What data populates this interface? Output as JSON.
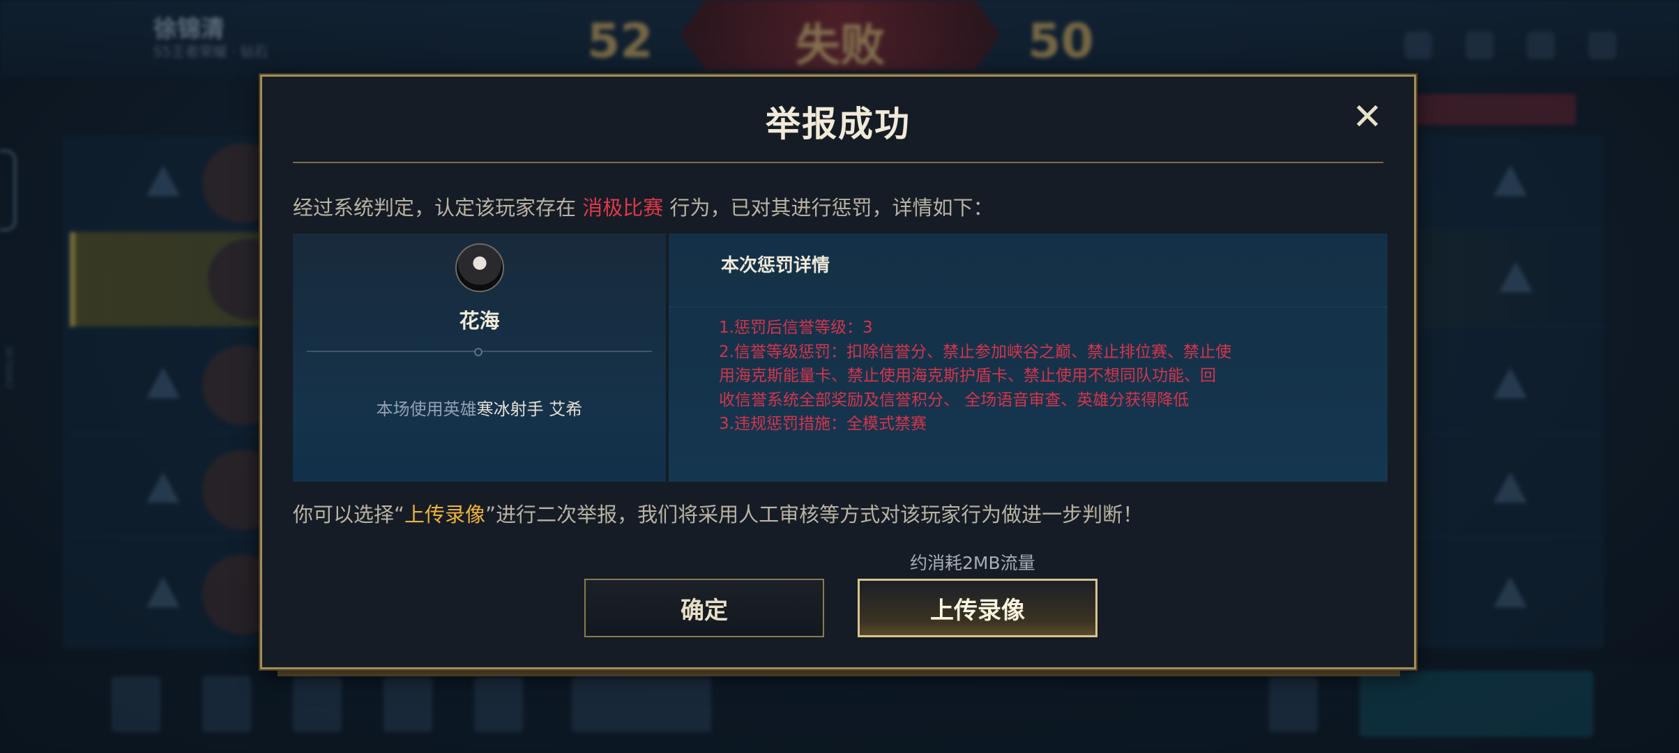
{
  "background": {
    "player_name": "徐锦清",
    "player_sub": "S5王者荣耀 · 钻石",
    "score_left": "52",
    "score_right": "50",
    "result_text": "失败",
    "side_text": "3670043"
  },
  "modal": {
    "title": "举报成功",
    "close_symbol": "✕",
    "intro_before": "经过系统判定，认定该玩家存在",
    "intro_highlight": "消极比赛",
    "intro_after": "行为，已对其进行惩罚，详情如下：",
    "player": {
      "name": "花海",
      "hero_label": "本场使用英雄",
      "hero_value": "寒冰射手 艾希"
    },
    "penalty": {
      "title": "本次惩罚详情",
      "lines": [
        "1.惩罚后信誉等级：3",
        "2.信誉等级惩罚：扣除信誉分、禁止参加峡谷之巅、禁止排位赛、禁止使",
        "用海克斯能量卡、禁止使用海克斯护盾卡、禁止使用不想同队功能、回",
        "收信誉系统全部奖励及信誉积分、 全场语音审查、英雄分获得降低",
        "3.违规惩罚措施：全模式禁赛"
      ]
    },
    "second_before": "你可以选择“",
    "second_highlight": "上传录像",
    "second_after": "”进行二次举报，我们将采用人工审核等方式对该玩家行为做进一步判断！",
    "traffic_note": "约消耗2MB流量",
    "buttons": {
      "confirm": "确定",
      "upload": "上传录像"
    }
  },
  "colors": {
    "accent_gold": "#a48b57",
    "highlight_red": "#e0394a",
    "highlight_yellow": "#f0b43a"
  }
}
